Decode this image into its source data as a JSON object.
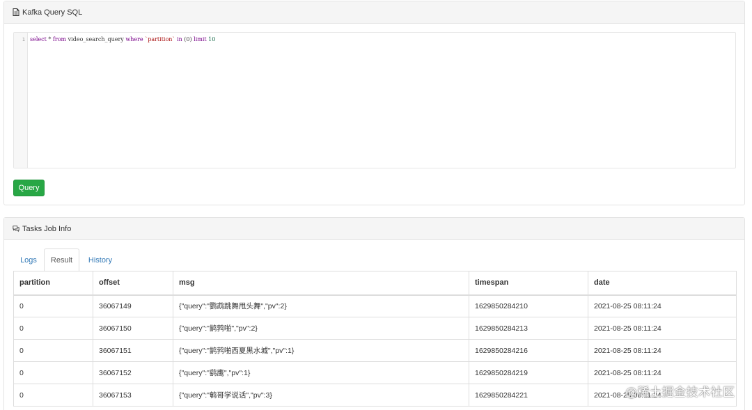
{
  "sql_panel": {
    "title": "Kafka Query SQL",
    "icon": "document-icon",
    "editor": {
      "line_number": "1",
      "tokens": {
        "select": "select",
        "star": " * ",
        "from": "from",
        "table": " video_search_query ",
        "where": "where",
        "space1": " ",
        "column": "`partition`",
        "space2": " ",
        "in": "in",
        "args": " (0) ",
        "limit": "limit",
        "space3": " ",
        "limit_value": "10"
      }
    },
    "query_button_label": "Query"
  },
  "tasks_panel": {
    "title": "Tasks Job Info",
    "icon": "comments-icon",
    "tabs": [
      {
        "label": "Logs",
        "active": false
      },
      {
        "label": "Result",
        "active": true
      },
      {
        "label": "History",
        "active": false
      }
    ],
    "table": {
      "columns": [
        "partition",
        "offset",
        "msg",
        "timespan",
        "date"
      ],
      "rows": [
        [
          "0",
          "36067149",
          "{\"query\":\"鹦鹉跳舞甩头舞\",\"pv\":2}",
          "1629850284210",
          "2021-08-25 08:11:24"
        ],
        [
          "0",
          "36067150",
          "{\"query\":\"鹋鹁啪\",\"pv\":2}",
          "1629850284213",
          "2021-08-25 08:11:24"
        ],
        [
          "0",
          "36067151",
          "{\"query\":\"鹋鹁啪西夏黑水城\",\"pv\":1}",
          "1629850284216",
          "2021-08-25 08:11:24"
        ],
        [
          "0",
          "36067152",
          "{\"query\":\"鹞鹰\",\"pv\":1}",
          "1629850284219",
          "2021-08-25 08:11:24"
        ],
        [
          "0",
          "36067153",
          "{\"query\":\"鹌哥学说话\",\"pv\":3}",
          "1629850284221",
          "2021-08-25 08:11:24"
        ]
      ]
    }
  },
  "watermark": "@稀土掘金技术社区",
  "colors": {
    "primary_link": "#337ab7",
    "success_button": "#28a745",
    "panel_heading_bg": "#f5f5f5"
  }
}
